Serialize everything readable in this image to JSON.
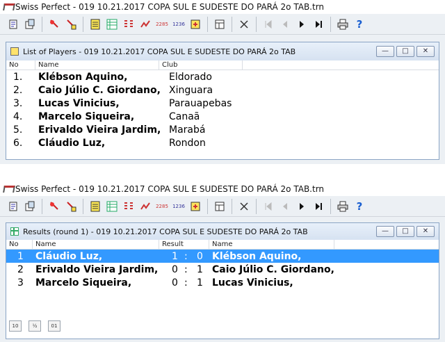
{
  "top_window": {
    "title": "Swiss Perfect - 019 10.21.2017 COPA SUL E SUDESTE DO PARÁ 2o TAB.trn",
    "players": {
      "title": "List of Players - 019 10.21.2017 COPA SUL E SUDESTE DO PARÁ 2o TAB",
      "columns": [
        "No",
        "Name",
        "Club"
      ],
      "rows": [
        {
          "no": "1.",
          "name": "Klébson Aquino,",
          "club": "Eldorado"
        },
        {
          "no": "2.",
          "name": "Caio Júlio C. Giordano,",
          "club": "Xinguara"
        },
        {
          "no": "3.",
          "name": "Lucas Vinicius,",
          "club": "Parauapebas"
        },
        {
          "no": "4.",
          "name": "Marcelo Siqueira,",
          "club": "Canaã"
        },
        {
          "no": "5.",
          "name": "Erivaldo Vieira Jardim,",
          "club": "Marabá"
        },
        {
          "no": "6.",
          "name": "Cláudio Luz,",
          "club": "Rondon"
        }
      ]
    }
  },
  "bottom_window": {
    "title": "Swiss Perfect - 019 10.21.2017 COPA SUL E SUDESTE DO PARÁ 2o TAB.trn",
    "results": {
      "title": "Results  (round 1) - 019 10.21.2017 COPA SUL E SUDESTE DO PARÁ 2o TAB",
      "columns": [
        "No",
        "Name",
        "Result",
        "Name"
      ],
      "rows": [
        {
          "no": "1",
          "white": "Cláudio Luz,",
          "r1": "1",
          "colon": ":",
          "r2": "0",
          "black": "Klébson Aquino,"
        },
        {
          "no": "2",
          "white": "Erivaldo Vieira Jardim,",
          "r1": "0",
          "colon": ":",
          "r2": "1",
          "black": "Caio Júlio C. Giordano,"
        },
        {
          "no": "3",
          "white": "Marcelo Siqueira,",
          "r1": "0",
          "colon": ":",
          "r2": "1",
          "black": "Lucas Vinicius,"
        }
      ],
      "bottom_buttons": [
        "10",
        "½",
        "01"
      ]
    }
  },
  "toolbar_icons": [
    "new-file-icon",
    "open-file-icon",
    "add-player-icon",
    "delete-player-icon",
    "notes-icon",
    "grid-icon",
    "pairing-icon",
    "standings-icon",
    "rating-2285-icon",
    "rating-1236-icon",
    "export-icon",
    "table-icon",
    "cross-icon",
    "first-icon",
    "prev-icon",
    "next-icon",
    "last-icon",
    "print-icon",
    "help-icon"
  ],
  "toolbar_labels": {
    "rating_a": "2285",
    "rating_b": "1236",
    "help": "?"
  },
  "window_buttons": {
    "min": "—",
    "max": "□",
    "close": "✕"
  }
}
